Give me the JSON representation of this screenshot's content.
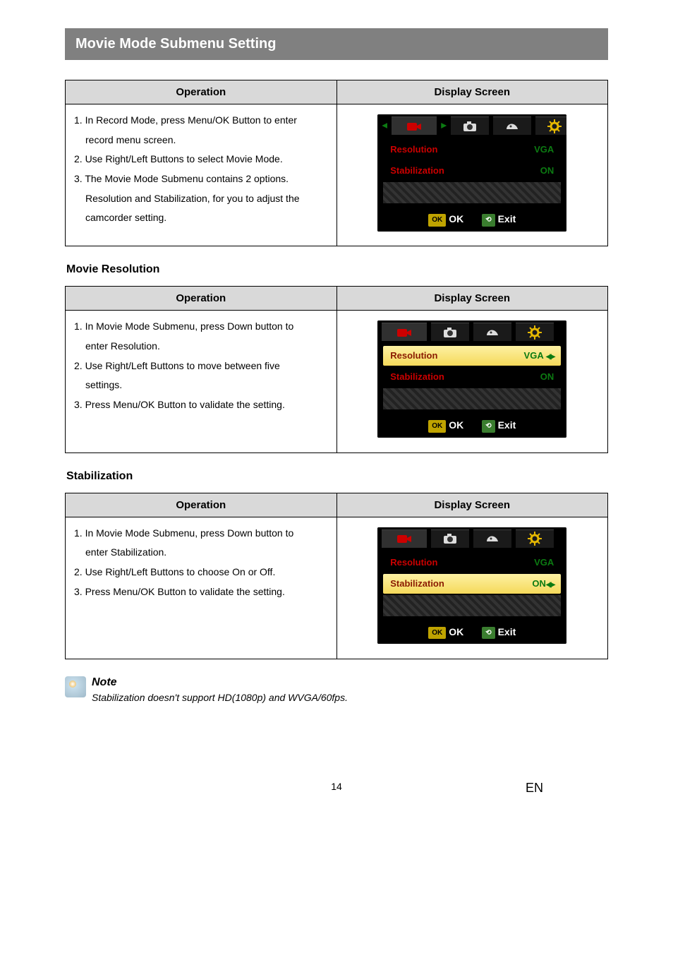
{
  "section_title": "Movie Mode Submenu Setting",
  "table1": {
    "col1": "Operation",
    "col2": "Display Screen",
    "lines": {
      "l1a": "1. In Record Mode, press Menu/OK Button to enter",
      "l1b": "record menu screen.",
      "l2": "2. Use Right/Left Buttons to select Movie Mode.",
      "l3a": "3. The Movie Mode Submenu contains 2 options.",
      "l3b": "Resolution and Stabilization, for you to adjust the",
      "l3c": "camcorder setting."
    },
    "screen": {
      "row1_label": "Resolution",
      "row1_value": "VGA",
      "row2_label": "Stabilization",
      "row2_value": "ON",
      "ok_chip": "OK",
      "ok_text": "OK",
      "exit_text": "Exit"
    }
  },
  "sub1_heading": "Movie Resolution",
  "table2": {
    "col1": "Operation",
    "col2": "Display Screen",
    "lines": {
      "l1a": "1. In Movie Mode Submenu, press Down button to",
      "l1b": "enter Resolution.",
      "l2a": "2. Use Right/Left Buttons to move between five",
      "l2b": "settings.",
      "l3": "3. Press Menu/OK Button to validate the setting."
    },
    "screen": {
      "row1_label": "Resolution",
      "row1_value": "VGA",
      "row2_label": "Stabilization",
      "row2_value": "ON",
      "ok_chip": "OK",
      "ok_text": "OK",
      "exit_text": "Exit"
    }
  },
  "sub2_heading": "Stabilization",
  "table3": {
    "col1": "Operation",
    "col2": "Display Screen",
    "lines": {
      "l1a": "1. In Movie Mode Submenu, press Down button to",
      "l1b": "enter Stabilization.",
      "l2": "2. Use Right/Left Buttons to choose On or Off.",
      "l3": "3. Press Menu/OK Button to validate the setting."
    },
    "screen": {
      "row1_label": "Resolution",
      "row1_value": "VGA",
      "row2_label": "Stabilization",
      "row2_value": "ON",
      "ok_chip": "OK",
      "ok_text": "OK",
      "exit_text": "Exit"
    }
  },
  "note": {
    "title": "Note",
    "text": "Stabilization doesn't support HD(1080p) and WVGA/60fps."
  },
  "footer": {
    "page": "14",
    "lang": "EN"
  }
}
